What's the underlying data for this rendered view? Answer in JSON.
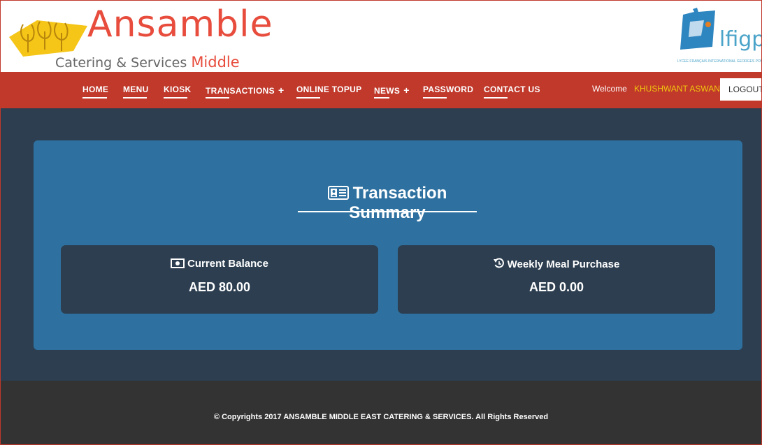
{
  "header": {
    "brand_name": "Ansamble",
    "brand_sub_plain": "Catering & Services",
    "brand_sub_accent": "Middle East",
    "partner_logo_text": "lfigp",
    "partner_logo_tagline": "LYCÉE FRANÇAIS INTERNATIONAL GEORGES POMPIDOU"
  },
  "nav": {
    "items": [
      {
        "label": "HOME",
        "has_submenu": false
      },
      {
        "label": "MENU",
        "has_submenu": false
      },
      {
        "label": "KIOSK",
        "has_submenu": false
      },
      {
        "label": "TRANSACTIONS",
        "has_submenu": true
      },
      {
        "label": "ONLINE TOPUP",
        "has_submenu": false
      },
      {
        "label": "NEWS",
        "has_submenu": true
      },
      {
        "label": "PASSWORD",
        "has_submenu": false
      },
      {
        "label": "CONTACT US",
        "has_submenu": false
      }
    ],
    "submenu_symbol": "+",
    "welcome_label": "Welcome",
    "username": "KHUSHWANT ASWANI",
    "logout_label": "LOGOUT"
  },
  "summary": {
    "title": "Transaction Summary",
    "title_icon": "id-card-icon",
    "cards": [
      {
        "title": "Current Balance",
        "icon": "money-bill-icon",
        "value": "AED 80.00"
      },
      {
        "title": "Weekly Meal Purchase",
        "icon": "history-icon",
        "value": "AED 0.00"
      }
    ]
  },
  "footer": {
    "copyright": "© Copyrights 2017 ANSAMBLE MIDDLE EAST CATERING & SERVICES. All Rights Reserved"
  },
  "colors": {
    "brand_red": "#e74c3c",
    "nav_bg": "#c0392b",
    "main_bg": "#2c3e50",
    "panel_blue": "#2e71a0",
    "card_bg": "#2c3e50",
    "footer_bg": "#333333",
    "username_yellow": "#f1c40f",
    "partner_blue": "#4aa3c8"
  }
}
